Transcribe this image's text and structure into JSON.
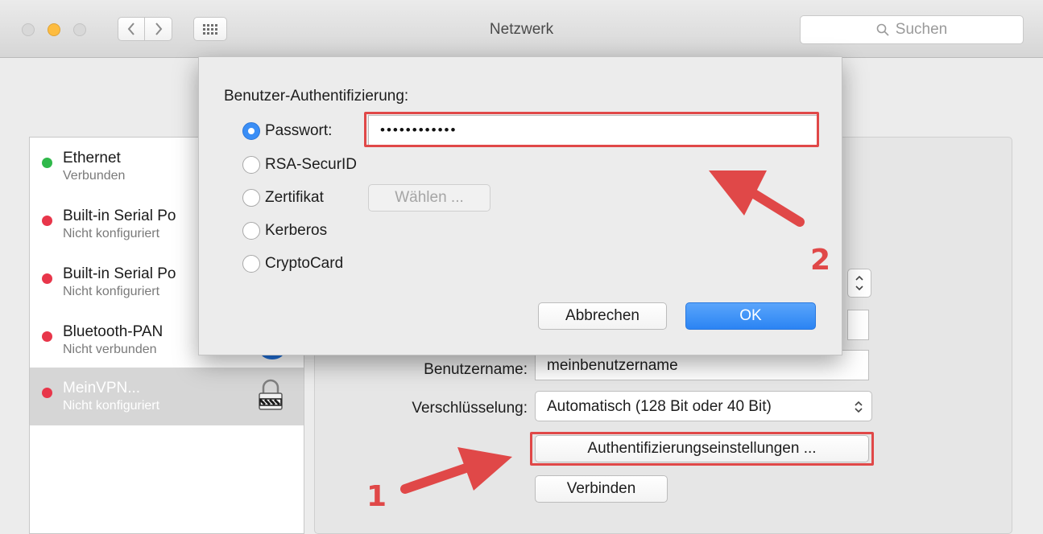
{
  "window": {
    "title": "Netzwerk",
    "search_placeholder": "Suchen"
  },
  "sidebar": {
    "items": [
      {
        "name": "Ethernet",
        "status": "Verbunden",
        "color": "#2fb84a"
      },
      {
        "name": "Built-in Serial Po",
        "status": "Nicht konfiguriert",
        "color": "#e8364a"
      },
      {
        "name": "Built-in Serial Po",
        "status": "Nicht konfiguriert",
        "color": "#e8364a"
      },
      {
        "name": "Bluetooth-PAN",
        "status": "Nicht verbunden",
        "color": "#e8364a"
      },
      {
        "name": "MeinVPN...",
        "status": "Nicht konfiguriert",
        "color": "#e8364a"
      }
    ]
  },
  "panel": {
    "username_label": "Benutzername:",
    "username_value": "meinbenutzername",
    "encryption_label": "Verschlüsselung:",
    "encryption_value": "Automatisch (128 Bit oder 40 Bit)",
    "auth_settings_button": "Authentifizierungseinstellungen ...",
    "connect_button": "Verbinden"
  },
  "sheet": {
    "title": "Benutzer-Authentifizierung:",
    "options": [
      {
        "label": "Passwort:",
        "selected": true
      },
      {
        "label": "RSA-SecurID",
        "selected": false
      },
      {
        "label": "Zertifikat",
        "selected": false
      },
      {
        "label": "Kerberos",
        "selected": false
      },
      {
        "label": "CryptoCard",
        "selected": false
      }
    ],
    "password_value": "••••••••••••",
    "choose_button": "Wählen ...",
    "cancel_button": "Abbrechen",
    "ok_button": "OK"
  },
  "annotations": {
    "step1": "1",
    "step2": "2",
    "color": "#e04848"
  }
}
